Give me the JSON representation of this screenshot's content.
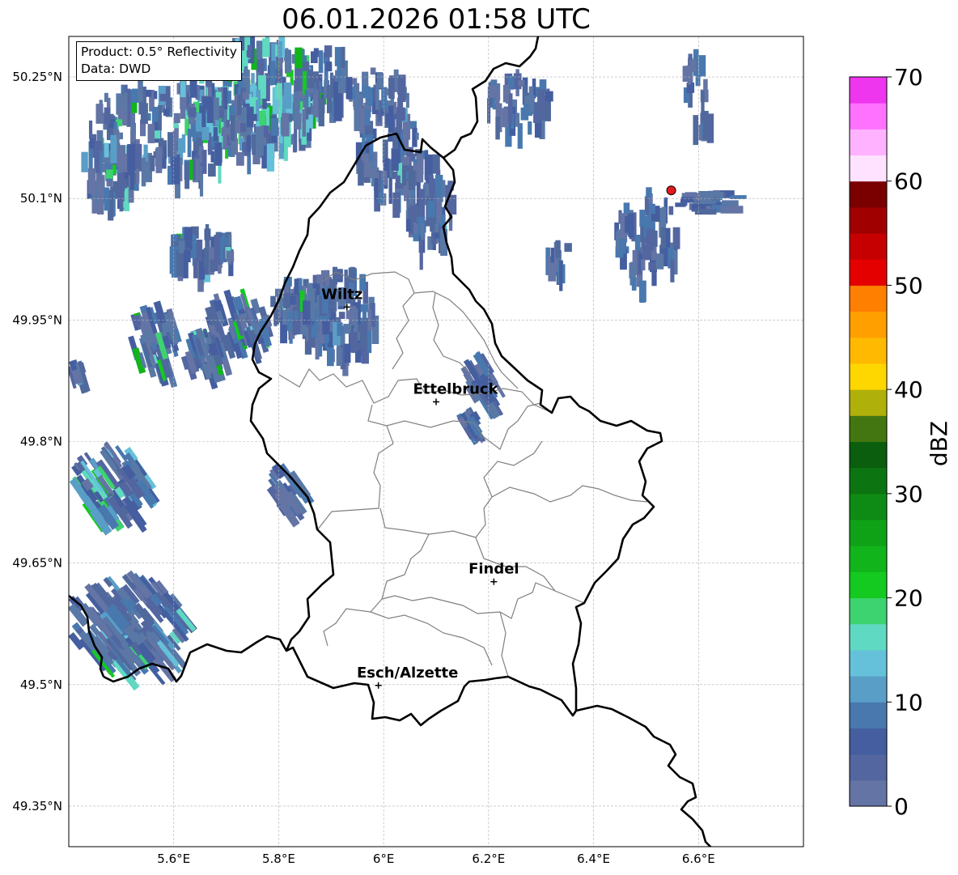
{
  "title": "06.01.2026 01:58 UTC",
  "info": {
    "product": "Product: 0.5° Reflectivity",
    "source": "Data: DWD"
  },
  "map": {
    "lon_range": [
      5.4,
      6.8
    ],
    "lat_range": [
      49.3,
      50.3
    ],
    "lat_ticks": [
      {
        "value": 49.35,
        "label": "49.35°N"
      },
      {
        "value": 49.5,
        "label": "49.5°N"
      },
      {
        "value": 49.65,
        "label": "49.65°N"
      },
      {
        "value": 49.8,
        "label": "49.8°N"
      },
      {
        "value": 49.95,
        "label": "49.95°N"
      },
      {
        "value": 50.1,
        "label": "50.1°N"
      },
      {
        "value": 50.25,
        "label": "50.25°N"
      }
    ],
    "lon_ticks": [
      {
        "value": 5.6,
        "label": "5.6°E"
      },
      {
        "value": 5.8,
        "label": "5.8°E"
      },
      {
        "value": 6.0,
        "label": "6°E"
      },
      {
        "value": 6.2,
        "label": "6.2°E"
      },
      {
        "value": 6.4,
        "label": "6.4°E"
      },
      {
        "value": 6.6,
        "label": "6.6°E"
      }
    ],
    "grid": true,
    "cities": [
      {
        "name": "Wiltz",
        "lon": 5.93,
        "lat": 49.966
      },
      {
        "name": "Ettelbruck",
        "lon": 6.1,
        "lat": 49.849
      },
      {
        "name": "Findel",
        "lon": 6.21,
        "lat": 49.627
      },
      {
        "name": "Esch/Alzette",
        "lon": 5.99,
        "lat": 49.499
      }
    ],
    "radar_site": {
      "lon": 6.548,
      "lat": 50.11,
      "color": "#e41a1c"
    }
  },
  "colorbar": {
    "label": "dBZ",
    "vmin": 0,
    "vmax": 70,
    "tick_values": [
      0,
      10,
      20,
      30,
      40,
      50,
      60,
      70
    ],
    "tick_labels": [
      "0",
      "10",
      "20",
      "30",
      "40",
      "50",
      "60",
      "70"
    ],
    "colors": [
      "#6474a4",
      "#5366a0",
      "#445e9f",
      "#4878ae",
      "#599ec6",
      "#65c1d9",
      "#5fd9c2",
      "#3dd370",
      "#14c91f",
      "#11b51b",
      "#0fa217",
      "#0e8b14",
      "#0c7410",
      "#0a5e0d",
      "#437610",
      "#b0b00a",
      "#ffd700",
      "#ffb900",
      "#ff9f00",
      "#ff7f00",
      "#e50000",
      "#c60000",
      "#a00000",
      "#7a0000",
      "#ffe2ff",
      "#ffb2ff",
      "#ff72ff",
      "#ee36ee"
    ]
  }
}
